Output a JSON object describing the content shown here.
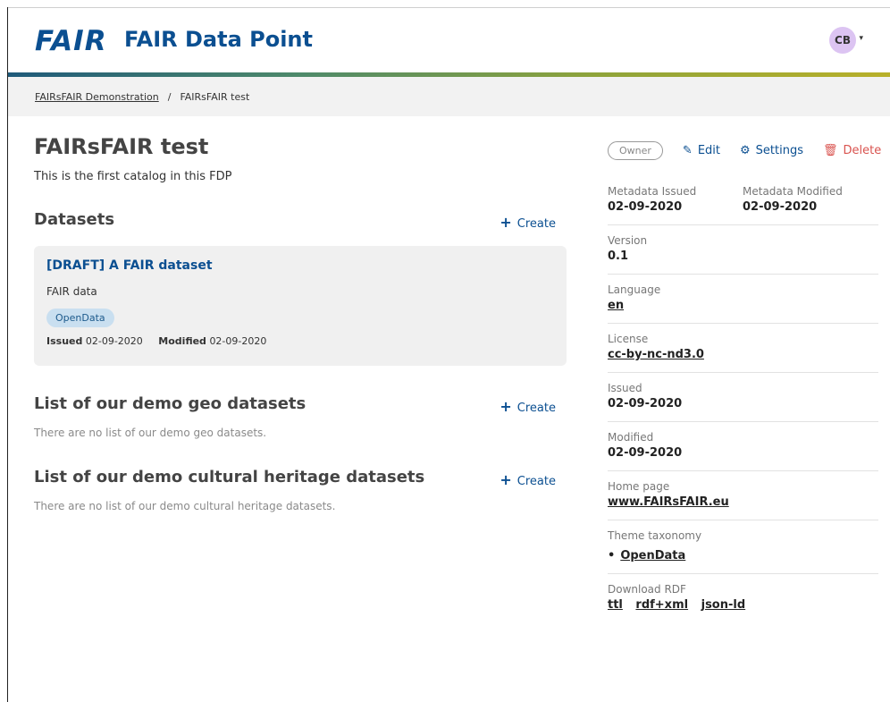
{
  "header": {
    "logo_text": "FAIR",
    "app_title": "FAIR Data Point",
    "user_initials": "CB"
  },
  "breadcrumb": {
    "parent": "FAIRsFAIR Demonstration",
    "separator": "/",
    "current": "FAIRsFAIR test"
  },
  "main": {
    "title": "FAIRsFAIR test",
    "description": "This is the first catalog in this FDP",
    "sections": [
      {
        "title": "Datasets",
        "create_label": "Create",
        "items": [
          {
            "title": "[DRAFT] A FAIR dataset",
            "description": "FAIR data",
            "tag": "OpenData",
            "issued_label": "Issued",
            "issued": "02-09-2020",
            "modified_label": "Modified",
            "modified": "02-09-2020"
          }
        ]
      },
      {
        "title": "List of our demo geo datasets",
        "create_label": "Create",
        "empty_text": "There are no list of our demo geo datasets."
      },
      {
        "title": "List of our demo cultural heritage datasets",
        "create_label": "Create",
        "empty_text": "There are no list of our demo cultural heritage datasets."
      }
    ]
  },
  "sidebar": {
    "owner_badge": "Owner",
    "edit_label": "Edit",
    "settings_label": "Settings",
    "delete_label": "Delete",
    "metadata_issued_label": "Metadata Issued",
    "metadata_issued": "02-09-2020",
    "metadata_modified_label": "Metadata Modified",
    "metadata_modified": "02-09-2020",
    "version_label": "Version",
    "version": "0.1",
    "language_label": "Language",
    "language": "en",
    "license_label": "License",
    "license": "cc-by-nc-nd3.0",
    "issued_label": "Issued",
    "issued": "02-09-2020",
    "modified_label": "Modified",
    "modified": "02-09-2020",
    "homepage_label": "Home page",
    "homepage": "www.FAIRsFAIR.eu",
    "theme_taxonomy_label": "Theme taxonomy",
    "theme_taxonomy": [
      "OpenData"
    ],
    "download_rdf_label": "Download RDF",
    "download_rdf": [
      "ttl",
      "rdf+xml",
      "json-ld"
    ]
  },
  "colors": {
    "brand": "#0b4f91",
    "delete": "#d9534f",
    "avatar": "#dcc4f2",
    "tag_bg": "#c9dff0"
  },
  "icons": {
    "edit": "edit-icon",
    "settings": "gear-icon",
    "delete": "trash-icon",
    "create": "plus-icon",
    "user_menu": "caret-down-icon"
  }
}
